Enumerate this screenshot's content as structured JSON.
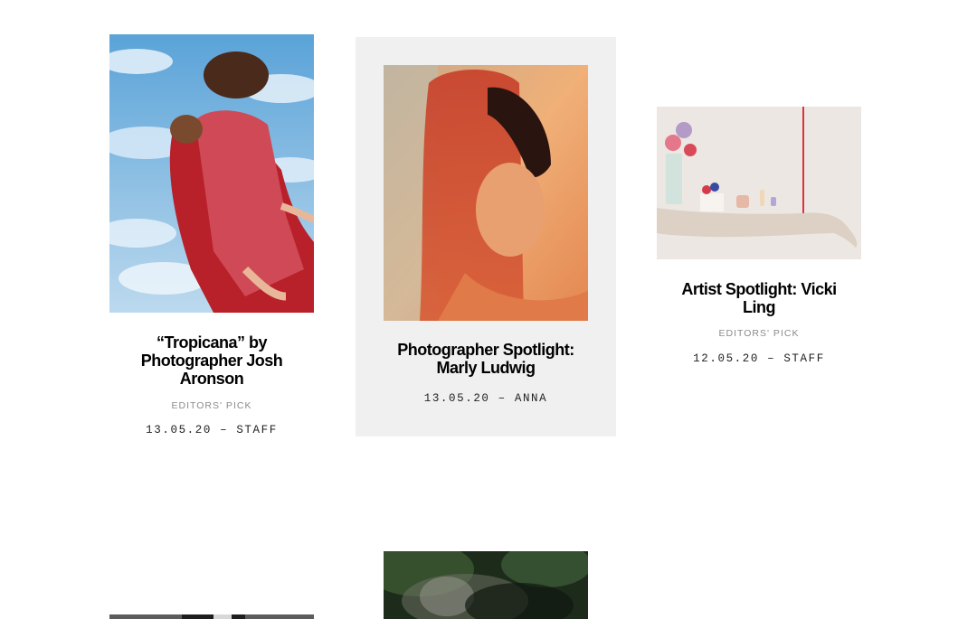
{
  "posts": [
    {
      "title": "“Tropicana” by Photographer Josh Aronson",
      "category": "EDITORS' PICK",
      "date": "13.05.20",
      "separator": "–",
      "author": "STAFF",
      "image": "fashion-photo-sky-red-outfit"
    },
    {
      "title": "Photographer Spotlight: Marly Ludwig",
      "category": "",
      "date": "13.05.20",
      "separator": "–",
      "author": "ANNA",
      "image": "portrait-red-veil-photo"
    },
    {
      "title": "Artist Spotlight: Vicki Ling",
      "category": "EDITORS' PICK",
      "date": "12.05.20",
      "separator": "–",
      "author": "STAFF",
      "image": "arm-still-life-artwork"
    },
    {
      "title": "",
      "category": "",
      "date": "",
      "separator": "",
      "author": "",
      "image": "black-white-photo-partial"
    },
    {
      "title": "",
      "category": "",
      "date": "",
      "separator": "",
      "author": "",
      "image": "dark-forest-photo-partial"
    }
  ],
  "colors": {
    "background": "#ffffff",
    "highlight_card": "#f0f0f0",
    "title": "#111111",
    "category": "#8a8a8a",
    "meta": "#222222"
  }
}
